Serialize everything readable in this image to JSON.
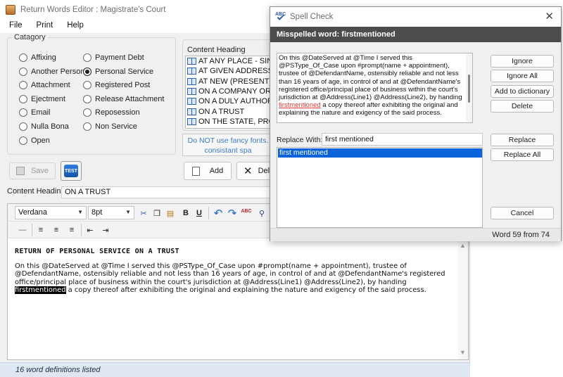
{
  "main_window": {
    "title": "Return Words Editor : Magistrate's Court",
    "menu": [
      "File",
      "Print",
      "Help"
    ],
    "category": {
      "legend": "Catagory",
      "col1": [
        "Affixing",
        "Another Person",
        "Attachment",
        "Ejectment",
        "Email",
        "Nulla Bona",
        "Open"
      ],
      "col2": [
        "Payment Debt",
        "Personal Service",
        "Registered Post",
        "Release Attachment",
        "Reposession",
        "Non Service"
      ],
      "selected": "Personal Service"
    },
    "content_heading_group": {
      "legend": "Content Heading",
      "items": [
        "AT ANY PLACE - SINGLE",
        "AT GIVEN ADDRESS",
        "AT NEW (PRESENT) ADDRESS",
        "ON A COMPANY OR BUSINESS",
        "ON A DULY AUTHORIZED",
        "ON A TRUST",
        "ON THE STATE, PROVINCE"
      ]
    },
    "fancy_note_line1": "Do NOT use fancy fonts.",
    "fancy_note_line2": "consistant spa",
    "buttons": {
      "save": "Save",
      "test": "TEST",
      "add": "Add",
      "delete": "Dele"
    },
    "content_heading_label": "Content Heading",
    "content_heading_value": "ON A TRUST",
    "editor": {
      "font": "Verdana",
      "size": "8pt",
      "toolbar_icons": [
        "cut-icon",
        "copy-icon",
        "paste-icon",
        "bold-icon",
        "underline-icon",
        "undo-icon",
        "redo-icon",
        "spellcheck-icon",
        "find-icon",
        "horizontal-line-icon",
        "align-left-icon",
        "align-center-icon",
        "align-right-icon",
        "outdent-icon",
        "indent-icon"
      ],
      "bold_label": "B",
      "underline_label": "U",
      "spell_label": "ABC",
      "doc_title": "RETURN OF PERSONAL SERVICE ON A TRUST",
      "doc_before": "On this @DateServed at @Time I served this @PSType_Of_Case upon #prompt(name + appointment), trustee of @DefendantName, ostensibly reliable and not less than 16 years of age, in control of and at @DefendantName's registered office/principal place of business within the court's jurisdiction at @Address(Line1) @Address(Line2), by handing ",
      "doc_highlight": "firstmentioned",
      "doc_after": " a copy thereof after exhibiting the original and explaining the nature and exigency of the said process."
    },
    "status": "16 word definitions listed"
  },
  "spell_check": {
    "title": "Spell Check",
    "banner": "Misspelled word: firstmentioned",
    "text_before": "On this @DateServed at @Time I served this @PSType_Of_Case upon #prompt(name + appointment), trustee of @DefendantName, ostensibly reliable and not less than 16 years of age, in control of and at @DefendantName's registered office/principal place of business within the court's jurisdiction at @Address(Line1) @Address(Line2), by handing ",
    "text_miss": "firstmentioned",
    "text_after": " a copy thereof after exhibiting the original and explaining the nature and exigency of the said process.",
    "buttons": {
      "ignore": "Ignore",
      "ignore_all": "Ignore All",
      "add_dictionary": "Add to dictionary",
      "delete": "Delete",
      "replace": "Replace",
      "replace_all": "Replace All",
      "cancel": "Cancel"
    },
    "replace_label": "Replace With:",
    "replace_value": "first mentioned",
    "suggestions": [
      "first mentioned"
    ],
    "status": "Word 59 from 74"
  },
  "colors": {
    "highlight": "#0a63d8",
    "banner": "#4c4c4c",
    "misspelled": "#e23a3a",
    "statusbar": "#dfe7f2",
    "note_text": "#3c79c4"
  }
}
